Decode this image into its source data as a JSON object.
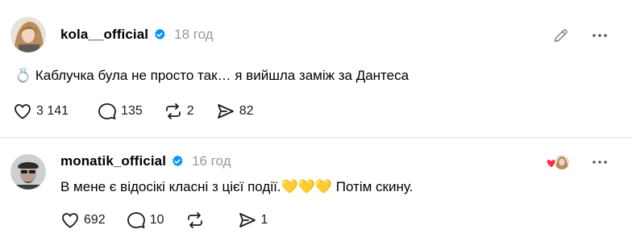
{
  "colors": {
    "verified_blue": "#0095f6",
    "muted_text": "#999999",
    "heart_red": "#ff3040"
  },
  "post": {
    "username": "kola__official",
    "time": "18 год",
    "text": "💍 Каблучка була не просто так… я вийшла заміж за Дантеса",
    "likes": "3 141",
    "comments": "135",
    "reposts": "2",
    "shares": "82",
    "icons": {
      "avatar": "avatar",
      "verified": "verified-badge-icon",
      "edit": "pencil-icon",
      "more": "more-icon"
    }
  },
  "reply": {
    "username": "monatik_official",
    "time": "16 год",
    "text": "В мене є відосікі класні з цієї події.💛💛💛 Потім скину.",
    "likes": "692",
    "comments": "10",
    "reposts": "",
    "shares": "1",
    "icons": {
      "avatar": "avatar",
      "verified": "verified-badge-icon",
      "liked_by_author": "liked-by-author-icon",
      "more": "more-icon"
    }
  }
}
